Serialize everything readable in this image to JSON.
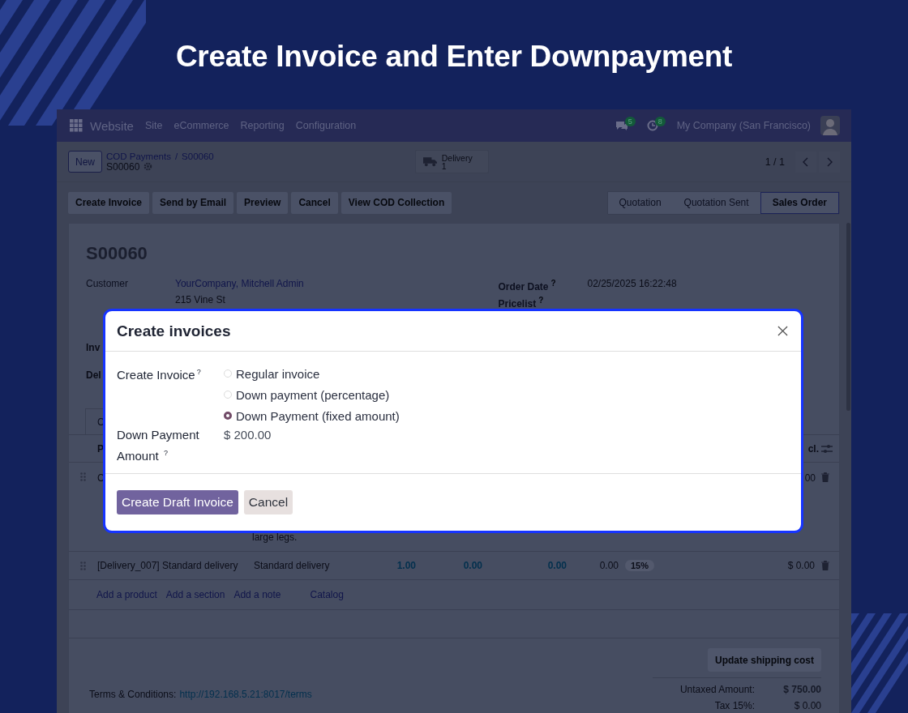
{
  "headline": "Create Invoice and Enter Downpayment",
  "navbar": {
    "app": "Website",
    "menu": [
      "Site",
      "eCommerce",
      "Reporting",
      "Configuration"
    ],
    "messages_count": "5",
    "activities_count": "8",
    "company": "My Company (San Francisco)"
  },
  "control_panel": {
    "new_button": "New",
    "breadcrumb_parent": "COD Payments",
    "breadcrumb_separator": "/",
    "breadcrumb_current": "S00060",
    "record": "S00060",
    "smart_button": {
      "label": "Delivery",
      "count": "1"
    },
    "pager": "1 / 1"
  },
  "actions": [
    "Create Invoice",
    "Send by Email",
    "Preview",
    "Cancel",
    "View COD Collection"
  ],
  "statusbar": [
    {
      "label": "Quotation",
      "selected": false
    },
    {
      "label": "Quotation Sent",
      "selected": false
    },
    {
      "label": "Sales Order",
      "selected": true
    }
  ],
  "form": {
    "title": "S00060",
    "customer_label": "Customer",
    "customer": "YourCompany, Mitchell Admin",
    "address": "215 Vine St",
    "order_date_label": "Order Date",
    "order_date_help": "?",
    "order_date": "02/25/2025 16:22:48",
    "pricelist_label": "Pricelist",
    "pricelist_help": "?",
    "label_3": "Inv",
    "label_4": "Del",
    "tab": "C",
    "column_1": "P",
    "column_last": "cl.",
    "line_1": {
      "column_1": "C",
      "description_end": "large legs.",
      "subtotal": "00"
    },
    "line_2": [
      {
        "text": "[Delivery_007] Standard delivery",
        "kind": "text"
      },
      {
        "text": "Standard delivery",
        "kind": "text"
      },
      {
        "text": "1.00",
        "kind": "editable"
      },
      {
        "text": "0.00",
        "kind": "editable"
      },
      {
        "text": "0.00",
        "kind": "editable"
      },
      {
        "text": "0.00",
        "kind": "number"
      },
      {
        "text": "15%",
        "kind": "tag"
      },
      {
        "text": "$ 0.00",
        "kind": "amount"
      }
    ],
    "add_links": [
      "Add a product",
      "Add a section",
      "Add a note",
      "Catalog"
    ],
    "update_button": "Update shipping cost",
    "terms_label": "Terms & Conditions:",
    "terms_link": "http://192.168.5.21:8017/terms",
    "totals": [
      {
        "label": "Untaxed Amount:",
        "value": "$ 750.00",
        "strong": true
      },
      {
        "label": "Tax 15%:",
        "value": "$ 0.00",
        "strong": false
      }
    ]
  },
  "dialog": {
    "title": "Create invoices",
    "invoice_label": "Create Invoice",
    "invoice_help": "?",
    "options": [
      {
        "label": "Regular invoice",
        "selected": false
      },
      {
        "label": "Down payment (percentage)",
        "selected": false
      },
      {
        "label": "Down Payment (fixed amount)",
        "selected": true
      }
    ],
    "amount_label": "Down Payment Amount",
    "amount_help": "?",
    "amount": "$ 200.00",
    "primary_button": "Create Draft Invoice",
    "cancel_button": "Cancel"
  }
}
